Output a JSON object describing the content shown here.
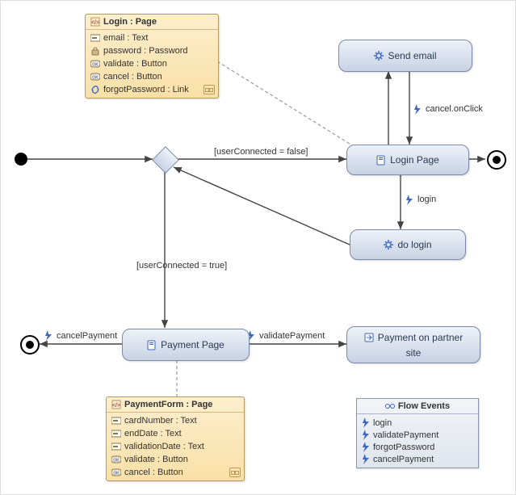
{
  "classes": {
    "login": {
      "title": "Login : Page",
      "attrs": [
        {
          "name": "email : Text",
          "icon": "field"
        },
        {
          "name": "password : Password",
          "icon": "lock"
        },
        {
          "name": "validate : Button",
          "icon": "button"
        },
        {
          "name": "cancel : Button",
          "icon": "button"
        },
        {
          "name": "forgotPassword : Link",
          "icon": "link"
        }
      ]
    },
    "payment": {
      "title": "PaymentForm : Page",
      "attrs": [
        {
          "name": "cardNumber : Text",
          "icon": "field"
        },
        {
          "name": "endDate : Text",
          "icon": "field"
        },
        {
          "name": "validationDate : Text",
          "icon": "field"
        },
        {
          "name": "validate : Button",
          "icon": "button"
        },
        {
          "name": "cancel : Button",
          "icon": "button"
        }
      ]
    }
  },
  "nodes": {
    "sendEmail": "Send email",
    "loginPage": "Login Page",
    "doLogin": "do login",
    "paymentPage": "Payment Page",
    "partner_l1": "Payment on partner",
    "partner_l2": "site"
  },
  "edges": {
    "guardFalse": "[userConnected = false]",
    "guardTrue": "[userConnected = true]",
    "cancelOnClick": "cancel.onClick",
    "login": "login",
    "validatePayment": "validatePayment",
    "cancelPayment": "cancelPayment"
  },
  "eventsBox": {
    "title": "Flow Events",
    "items": [
      "login",
      "validatePayment",
      "forgotPassword",
      "cancelPayment"
    ]
  },
  "icons": {
    "bolt": "bolt-icon",
    "page": "page-icon",
    "gear": "gear-icon",
    "link": "link-icon",
    "field": "field-icon",
    "lock": "lock-icon",
    "button": "button-icon",
    "class": "class-icon",
    "subflow": "subflow-icon",
    "eventsTitle": "events-title-icon"
  },
  "chart_data": {
    "type": "diagram",
    "title": "Activity / Flow diagram with class details",
    "initial_nodes": [
      "start"
    ],
    "final_nodes": [
      "end-right",
      "end-left"
    ],
    "decision_nodes": [
      "d1"
    ],
    "activities": [
      {
        "id": "sendEmail",
        "label": "Send email",
        "kind": "action"
      },
      {
        "id": "loginPage",
        "label": "Login Page",
        "kind": "page"
      },
      {
        "id": "doLogin",
        "label": "do login",
        "kind": "action"
      },
      {
        "id": "paymentPage",
        "label": "Payment Page",
        "kind": "page"
      },
      {
        "id": "partnerSite",
        "label": "Payment on partner site",
        "kind": "subflow"
      }
    ],
    "edges": [
      {
        "from": "start",
        "to": "d1"
      },
      {
        "from": "d1",
        "to": "loginPage",
        "guard": "userConnected = false"
      },
      {
        "from": "d1",
        "to": "paymentPage",
        "guard": "userConnected = true"
      },
      {
        "from": "loginPage",
        "to": "end-right"
      },
      {
        "from": "loginPage",
        "to": "sendEmail"
      },
      {
        "from": "sendEmail",
        "to": "loginPage",
        "event": "cancel.onClick"
      },
      {
        "from": "loginPage",
        "to": "doLogin",
        "event": "login"
      },
      {
        "from": "doLogin",
        "to": "d1"
      },
      {
        "from": "paymentPage",
        "to": "partnerSite",
        "event": "validatePayment"
      },
      {
        "from": "paymentPage",
        "to": "end-left",
        "event": "cancelPayment"
      },
      {
        "from": "loginClass",
        "to": "loginPage",
        "kind": "note-link"
      },
      {
        "from": "paymentClass",
        "to": "paymentPage",
        "kind": "note-link"
      }
    ],
    "class_details": [
      {
        "id": "loginClass",
        "name": "Login",
        "stereotype": "Page",
        "attributes": [
          {
            "name": "email",
            "type": "Text"
          },
          {
            "name": "password",
            "type": "Password"
          },
          {
            "name": "validate",
            "type": "Button"
          },
          {
            "name": "cancel",
            "type": "Button"
          },
          {
            "name": "forgotPassword",
            "type": "Link"
          }
        ]
      },
      {
        "id": "paymentClass",
        "name": "PaymentForm",
        "stereotype": "Page",
        "attributes": [
          {
            "name": "cardNumber",
            "type": "Text"
          },
          {
            "name": "endDate",
            "type": "Text"
          },
          {
            "name": "validationDate",
            "type": "Text"
          },
          {
            "name": "validate",
            "type": "Button"
          },
          {
            "name": "cancel",
            "type": "Button"
          }
        ]
      }
    ],
    "flow_events": [
      "login",
      "validatePayment",
      "forgotPassword",
      "cancelPayment"
    ]
  }
}
